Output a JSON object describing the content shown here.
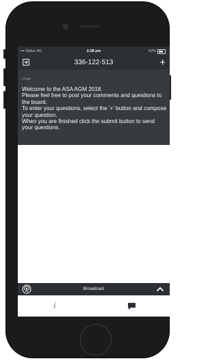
{
  "status_bar": {
    "carrier": "Optus  4G",
    "time": "2:28 pm",
    "battery": "62%"
  },
  "app_bar": {
    "title": "336-122-513",
    "left_icon": "exit-icon",
    "right_icon": "plus-icon",
    "add_label": "+"
  },
  "message": {
    "sender": "Chair",
    "text": "Welcome to the ASA AGM 2018.\nPlease feel free to post your comments and questions to the board.\nTo enter your questions, select the '+' button and compose your question.\nWhen you are finished click the submit button to send your questions."
  },
  "bottom_bar": {
    "label": "Broadcast",
    "left_icon": "broadcast-icon",
    "right_icon": "chevron-up-icon"
  },
  "tabs": {
    "info_label": "i",
    "chat_icon": "chat-icon"
  },
  "colors": {
    "bar_bg": "#2c2f33",
    "message_bg": "#373a3e",
    "phone_body": "#1b1b1c"
  }
}
